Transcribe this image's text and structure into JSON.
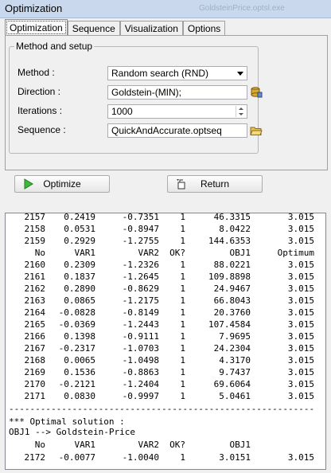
{
  "window": {
    "title": "Optimization",
    "ghost_caption": "GoldsteinPrice.optsl.exe"
  },
  "tabs": [
    "Optimization",
    "Sequence",
    "Visualization",
    "Options"
  ],
  "setup": {
    "group_title": "Method and setup",
    "method_label": "Method :",
    "method_value": "Random search (RND)",
    "direction_label": "Direction :",
    "direction_value": "Goldstein-(MIN);",
    "iterations_label": "Iterations :",
    "iterations_value": "1000",
    "sequence_label": "Sequence :",
    "sequence_value": "QuickAndAccurate.optseq"
  },
  "buttons": {
    "optimize": "Optimize",
    "return": "Return"
  },
  "output": {
    "rows_top": [
      [
        "2157",
        "0.2419",
        "-0.7351",
        "1",
        "46.3315",
        "3.015"
      ],
      [
        "2158",
        "0.0531",
        "-0.8947",
        "1",
        "8.0422",
        "3.015"
      ],
      [
        "2159",
        "0.2929",
        "-1.2755",
        "1",
        "144.6353",
        "3.015"
      ]
    ],
    "header": [
      "No",
      "VAR1",
      "VAR2",
      "OK?",
      "OBJ1",
      "Optimum"
    ],
    "rows": [
      [
        "2160",
        "0.2309",
        "-1.2326",
        "1",
        "88.0221",
        "3.015"
      ],
      [
        "2161",
        "0.1837",
        "-1.2645",
        "1",
        "109.8898",
        "3.015"
      ],
      [
        "2162",
        "0.2890",
        "-0.8629",
        "1",
        "24.9467",
        "3.015"
      ],
      [
        "2163",
        "0.0865",
        "-1.2175",
        "1",
        "66.8043",
        "3.015"
      ],
      [
        "2164",
        "-0.0828",
        "-0.8149",
        "1",
        "20.3760",
        "3.015"
      ],
      [
        "2165",
        "-0.0369",
        "-1.2443",
        "1",
        "107.4584",
        "3.015"
      ],
      [
        "2166",
        "0.1398",
        "-0.9111",
        "1",
        "7.9695",
        "3.015"
      ],
      [
        "2167",
        "-0.2317",
        "-1.0703",
        "1",
        "24.2304",
        "3.015"
      ],
      [
        "2168",
        "0.0065",
        "-1.0498",
        "1",
        "4.3170",
        "3.015"
      ],
      [
        "2169",
        "0.1536",
        "-0.8863",
        "1",
        "9.7437",
        "3.015"
      ],
      [
        "2170",
        "-0.2121",
        "-1.2404",
        "1",
        "69.6064",
        "3.015"
      ],
      [
        "2171",
        "0.0830",
        "-0.9997",
        "1",
        "5.0461",
        "3.015"
      ]
    ],
    "separator": "----------------------------------------------------------",
    "optimal_title": "*** Optimal solution :",
    "objective_line": "OBJ1 --> Goldstein-Price",
    "final_header": [
      "No",
      "VAR1",
      "VAR2",
      "OK?",
      "OBJ1",
      ""
    ],
    "final_row": [
      "2172",
      "-0.0077",
      "-1.0040",
      "1",
      "3.0151",
      "3.015"
    ]
  }
}
